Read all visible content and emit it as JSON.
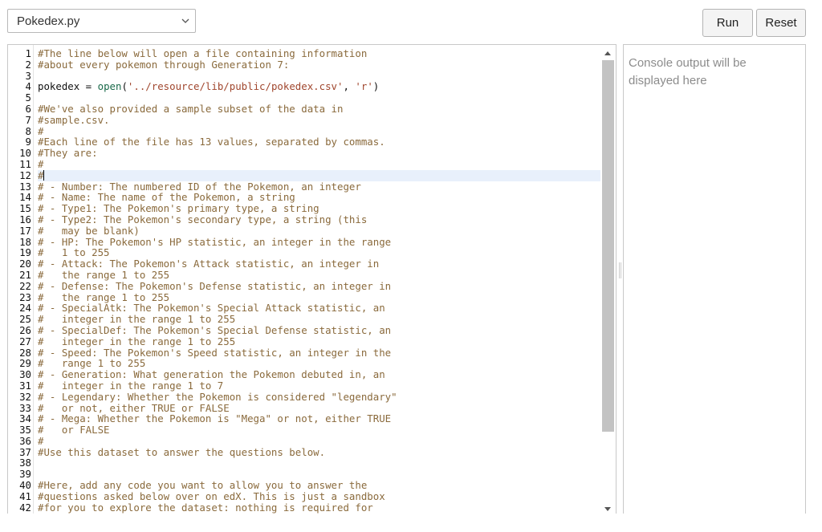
{
  "toolbar": {
    "file_selected": "Pokedex.py",
    "run_label": "Run",
    "reset_label": "Reset"
  },
  "console": {
    "placeholder": "Console output will be displayed here"
  },
  "editor": {
    "active_line": 12,
    "lines": [
      {
        "n": "1",
        "t": [
          [
            "comment",
            "#The line below will open a file containing information"
          ]
        ]
      },
      {
        "n": "2",
        "t": [
          [
            "comment",
            "#about every pokemon through Generation 7:"
          ]
        ]
      },
      {
        "n": "3",
        "t": []
      },
      {
        "n": "4",
        "t": [
          [
            "plain",
            "pokedex = "
          ],
          [
            "func",
            "open"
          ],
          [
            "plain",
            "("
          ],
          [
            "string",
            "'../resource/lib/public/pokedex.csv'"
          ],
          [
            "plain",
            ", "
          ],
          [
            "string",
            "'r'"
          ],
          [
            "plain",
            ")"
          ]
        ]
      },
      {
        "n": "5",
        "t": []
      },
      {
        "n": "6",
        "t": [
          [
            "comment",
            "#We've also provided a sample subset of the data in"
          ]
        ]
      },
      {
        "n": "7",
        "t": [
          [
            "comment",
            "#sample.csv."
          ]
        ]
      },
      {
        "n": "8",
        "t": [
          [
            "comment",
            "#"
          ]
        ]
      },
      {
        "n": "9",
        "t": [
          [
            "comment",
            "#Each line of the file has 13 values, separated by commas."
          ]
        ]
      },
      {
        "n": "10",
        "t": [
          [
            "comment",
            "#They are:"
          ]
        ]
      },
      {
        "n": "11",
        "t": [
          [
            "comment",
            "#"
          ]
        ]
      },
      {
        "n": "12",
        "t": [
          [
            "comment",
            "#"
          ]
        ]
      },
      {
        "n": "13",
        "t": [
          [
            "comment",
            "# - Number: The numbered ID of the Pokemon, an integer"
          ]
        ]
      },
      {
        "n": "14",
        "t": [
          [
            "comment",
            "# - Name: The name of the Pokemon, a string"
          ]
        ]
      },
      {
        "n": "15",
        "t": [
          [
            "comment",
            "# - Type1: The Pokemon's primary type, a string"
          ]
        ]
      },
      {
        "n": "16",
        "t": [
          [
            "comment",
            "# - Type2: The Pokemon's secondary type, a string (this"
          ]
        ]
      },
      {
        "n": "17",
        "t": [
          [
            "comment",
            "#   may be blank)"
          ]
        ]
      },
      {
        "n": "18",
        "t": [
          [
            "comment",
            "# - HP: The Pokemon's HP statistic, an integer in the range"
          ]
        ]
      },
      {
        "n": "19",
        "t": [
          [
            "comment",
            "#   1 to 255"
          ]
        ]
      },
      {
        "n": "20",
        "t": [
          [
            "comment",
            "# - Attack: The Pokemon's Attack statistic, an integer in"
          ]
        ]
      },
      {
        "n": "21",
        "t": [
          [
            "comment",
            "#   the range 1 to 255"
          ]
        ]
      },
      {
        "n": "22",
        "t": [
          [
            "comment",
            "# - Defense: The Pokemon's Defense statistic, an integer in"
          ]
        ]
      },
      {
        "n": "23",
        "t": [
          [
            "comment",
            "#   the range 1 to 255"
          ]
        ]
      },
      {
        "n": "24",
        "t": [
          [
            "comment",
            "# - SpecialAtk: The Pokemon's Special Attack statistic, an"
          ]
        ]
      },
      {
        "n": "25",
        "t": [
          [
            "comment",
            "#   integer in the range 1 to 255"
          ]
        ]
      },
      {
        "n": "26",
        "t": [
          [
            "comment",
            "# - SpecialDef: The Pokemon's Special Defense statistic, an"
          ]
        ]
      },
      {
        "n": "27",
        "t": [
          [
            "comment",
            "#   integer in the range 1 to 255"
          ]
        ]
      },
      {
        "n": "28",
        "t": [
          [
            "comment",
            "# - Speed: The Pokemon's Speed statistic, an integer in the"
          ]
        ]
      },
      {
        "n": "29",
        "t": [
          [
            "comment",
            "#   range 1 to 255"
          ]
        ]
      },
      {
        "n": "30",
        "t": [
          [
            "comment",
            "# - Generation: What generation the Pokemon debuted in, an"
          ]
        ]
      },
      {
        "n": "31",
        "t": [
          [
            "comment",
            "#   integer in the range 1 to 7"
          ]
        ]
      },
      {
        "n": "32",
        "t": [
          [
            "comment",
            "# - Legendary: Whether the Pokemon is considered \"legendary\""
          ]
        ]
      },
      {
        "n": "33",
        "t": [
          [
            "comment",
            "#   or not, either TRUE or FALSE"
          ]
        ]
      },
      {
        "n": "34",
        "t": [
          [
            "comment",
            "# - Mega: Whether the Pokemon is \"Mega\" or not, either TRUE"
          ]
        ]
      },
      {
        "n": "35",
        "t": [
          [
            "comment",
            "#   or FALSE"
          ]
        ]
      },
      {
        "n": "36",
        "t": [
          [
            "comment",
            "#"
          ]
        ]
      },
      {
        "n": "37",
        "t": [
          [
            "comment",
            "#Use this dataset to answer the questions below."
          ]
        ]
      },
      {
        "n": "38",
        "t": []
      },
      {
        "n": "39",
        "t": []
      },
      {
        "n": "40",
        "t": [
          [
            "comment",
            "#Here, add any code you want to allow you to answer the"
          ]
        ]
      },
      {
        "n": "41",
        "t": [
          [
            "comment",
            "#questions asked below over on edX. This is just a sandbox"
          ]
        ]
      },
      {
        "n": "42",
        "t": [
          [
            "comment",
            "#for you to explore the dataset: nothing is required for"
          ]
        ]
      }
    ]
  }
}
